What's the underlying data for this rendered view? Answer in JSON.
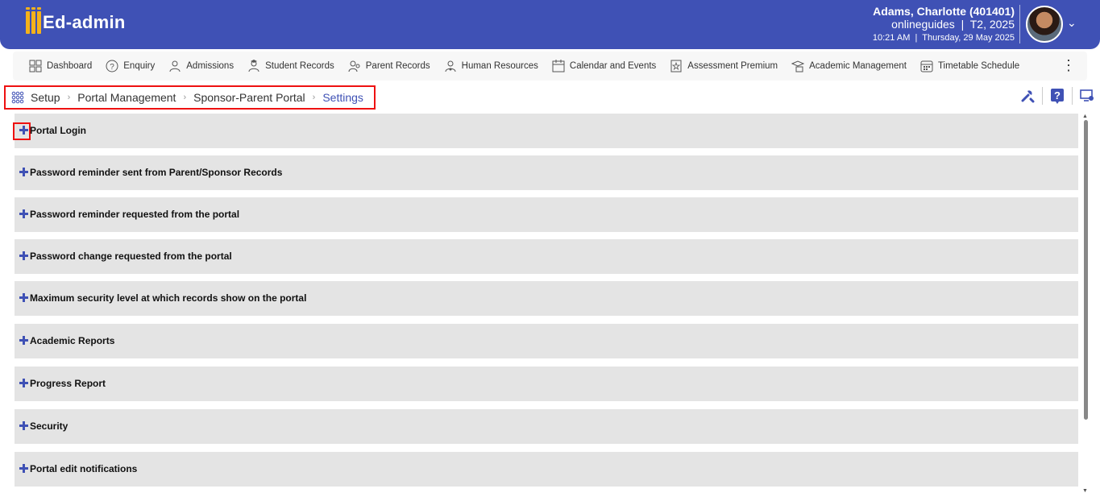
{
  "app": {
    "logo_text": "Ed-admin"
  },
  "user": {
    "name": "Adams, Charlotte (401401)",
    "context": "onlineguides  |  T2, 2025",
    "datetime": "10:21 AM  |  Thursday, 29 May 2025"
  },
  "nav": {
    "items": [
      {
        "label": "Dashboard",
        "icon": "dashboard-icon"
      },
      {
        "label": "Enquiry",
        "icon": "question-icon"
      },
      {
        "label": "Admissions",
        "icon": "admissions-icon"
      },
      {
        "label": "Student Records",
        "icon": "student-records-icon"
      },
      {
        "label": "Parent Records",
        "icon": "parent-records-icon"
      },
      {
        "label": "Human Resources",
        "icon": "human-resources-icon"
      },
      {
        "label": "Calendar and Events",
        "icon": "calendar-icon"
      },
      {
        "label": "Assessment Premium",
        "icon": "assessment-icon"
      },
      {
        "label": "Academic Management",
        "icon": "academic-icon"
      },
      {
        "label": "Timetable Schedule",
        "icon": "timetable-icon"
      }
    ]
  },
  "breadcrumb": {
    "items": [
      "Setup",
      "Portal Management",
      "Sponsor-Parent Portal",
      "Settings"
    ]
  },
  "panels": [
    "Portal Login",
    "Password reminder sent from Parent/Sponsor Records",
    "Password reminder requested from the portal",
    "Password change requested from the portal",
    "Maximum security level at which records show on the portal",
    "Academic Reports",
    "Progress Report",
    "Security",
    "Portal edit notifications"
  ],
  "colors": {
    "brand": "#3f51b5",
    "accent": "#f5b21a",
    "highlight": "#ee1111",
    "panel_bg": "#e4e4e4"
  }
}
